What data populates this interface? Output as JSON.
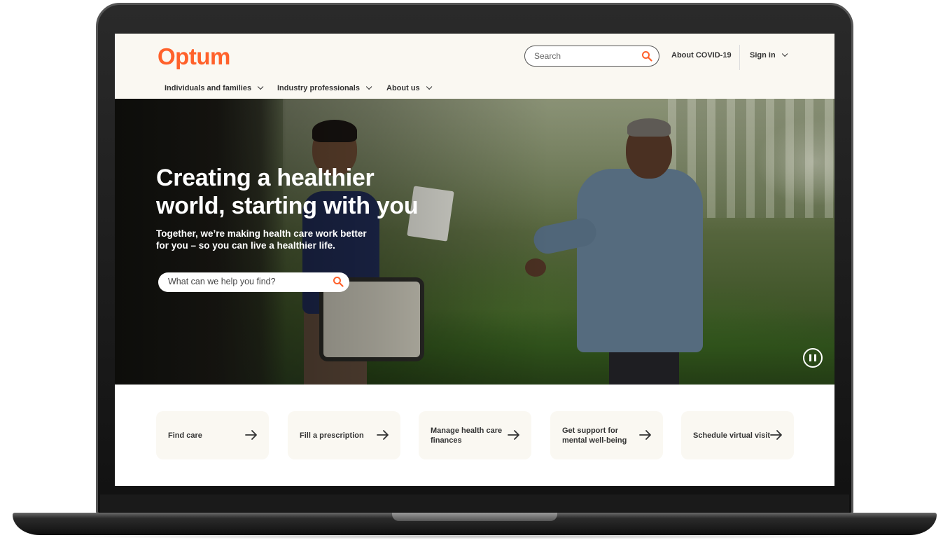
{
  "header": {
    "logo": "Optum",
    "search_placeholder": "Search",
    "covid_link": "About COVID-19",
    "signin": "Sign in",
    "nav": [
      "Individuals and families",
      "Industry professionals",
      "About us"
    ]
  },
  "hero": {
    "headline_line1": "Creating a healthier",
    "headline_line2": "world, starting with you",
    "sub_line1": "Together, we’re making health care work better",
    "sub_line2": "for you – so you can live a healthier life.",
    "search_placeholder": "What can we help you find?"
  },
  "cards": [
    {
      "line1": "Find care",
      "line2": ""
    },
    {
      "line1": "Fill a prescription",
      "line2": ""
    },
    {
      "line1": "Manage health care",
      "line2": "finances"
    },
    {
      "line1": "Get support for",
      "line2": "mental well-being"
    },
    {
      "line1": "Schedule virtual visit",
      "line2": ""
    }
  ],
  "colors": {
    "brand": "#ff612b",
    "header_bg": "#faf8f2",
    "card_bg": "#faf8f2",
    "text": "#333333"
  },
  "icons": {
    "search": "search-icon",
    "arrow": "arrow-right-icon",
    "chevron": "chevron-down-icon",
    "pause": "pause-icon"
  }
}
